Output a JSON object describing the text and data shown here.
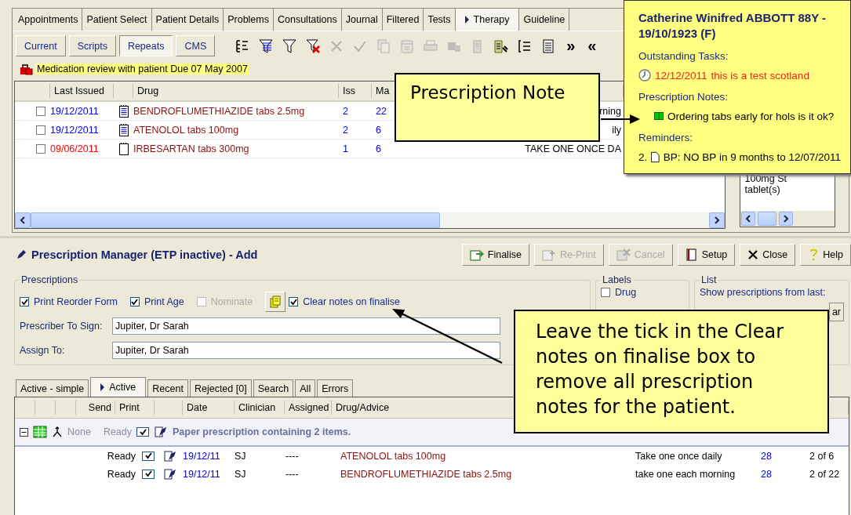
{
  "top_tabs": [
    {
      "label": "Appointments",
      "selected": false
    },
    {
      "label": "Patient Select",
      "selected": false
    },
    {
      "label": "Patient Details",
      "selected": false
    },
    {
      "label": "Problems",
      "selected": false
    },
    {
      "label": "Consultations",
      "selected": false
    },
    {
      "label": "Journal",
      "selected": false
    },
    {
      "label": "Filtered",
      "selected": false
    },
    {
      "label": "Tests",
      "selected": false
    },
    {
      "label": "Therapy",
      "selected": true
    },
    {
      "label": "Guideline",
      "selected": false
    }
  ],
  "therapy_toolbar": {
    "views": [
      {
        "label": "Current",
        "selected": false
      },
      {
        "label": "Scripts",
        "selected": false
      },
      {
        "label": "Repeats",
        "selected": true
      },
      {
        "label": "CMS",
        "selected": false
      }
    ],
    "tools": [
      {
        "kind": "tree-list",
        "disabled": false
      },
      {
        "kind": "filter-lines",
        "disabled": false
      },
      {
        "kind": "filter",
        "disabled": false
      },
      {
        "kind": "filter-delete",
        "disabled": false
      },
      {
        "kind": "cross",
        "disabled": true
      },
      {
        "kind": "tick",
        "disabled": true
      },
      {
        "kind": "copy",
        "disabled": true
      },
      {
        "kind": "calendar",
        "disabled": true
      },
      {
        "kind": "printer",
        "disabled": true
      },
      {
        "kind": "stamp",
        "disabled": true
      },
      {
        "kind": "form",
        "disabled": true
      },
      {
        "kind": "list-pen",
        "disabled": false
      },
      {
        "kind": "bracket-list",
        "disabled": false
      },
      {
        "kind": "page-list",
        "disabled": false
      }
    ],
    "expand": "»",
    "collapse": "«"
  },
  "alert": "Medication review with patient Due 07 May 2007",
  "repeats_table": {
    "columns": [
      "Last Issued",
      "Drug",
      "Iss",
      "Ma"
    ],
    "rows": [
      {
        "checked": false,
        "last_issued": "19/12/2011",
        "color": "#0000ff",
        "kind": "lined",
        "drug": "BENDROFLUMETHIAZIDE tabs 2.5mg",
        "iss": "2",
        "max": "22",
        "dosage": "rning"
      },
      {
        "checked": false,
        "last_issued": "19/12/2011",
        "color": "#0000ff",
        "kind": "lined",
        "drug": "ATENOLOL tabs 100mg",
        "iss": "2",
        "max": "6",
        "dosage": "ily"
      },
      {
        "checked": false,
        "last_issued": "09/06/2011",
        "color": "#ff0000",
        "kind": "plain",
        "drug": "IRBESARTAN tabs 300mg",
        "iss": "1",
        "max": "6",
        "dosage": "TAKE ONE ONCE DA"
      }
    ]
  },
  "side_panel": {
    "lines": [
      "100mg St",
      "tablet(s)"
    ]
  },
  "patient_popup": {
    "title": "Catherine Winifred ABBOTT 88Y - 19/10/1923 (F)",
    "sections": [
      {
        "heading": "Outstanding Tasks:",
        "kind": "task",
        "date": "12/12/2011",
        "text": "this is a test scotland"
      },
      {
        "heading": "Prescription Notes:",
        "kind": "note",
        "text": "Ordering tabs early for hols is it ok?"
      },
      {
        "heading": "Reminders:",
        "kind": "reminder",
        "number": "2.",
        "text": "BP: NO BP in 9 months to 12/07/2011"
      }
    ]
  },
  "prescription_manager": {
    "title": "Prescription Manager (ETP inactive) - Add",
    "actions": [
      {
        "label": "Finalise",
        "kind": "finalise",
        "disabled": false
      },
      {
        "label": "Re-Print",
        "kind": "reprint",
        "disabled": true
      },
      {
        "label": "Cancel",
        "kind": "cancel",
        "disabled": true
      },
      {
        "label": "Setup",
        "kind": "setup",
        "disabled": false
      },
      {
        "label": "Close",
        "kind": "close",
        "disabled": false
      },
      {
        "label": "Help",
        "kind": "help",
        "disabled": false
      }
    ],
    "prescriptions_group": {
      "title": "Prescriptions",
      "options": [
        {
          "label": "Print Reorder Form",
          "checked": true,
          "disabled": false
        },
        {
          "label": "Print Age",
          "checked": true,
          "disabled": false
        },
        {
          "label": "Nominate",
          "checked": false,
          "disabled": true
        }
      ],
      "clear_notes": {
        "label": "Clear notes on finalise",
        "checked": true
      },
      "fields": [
        {
          "label": "Prescriber To Sign:",
          "value": "Jupiter, Dr Sarah"
        },
        {
          "label": "Assign To:",
          "value": "Jupiter, Dr Sarah"
        }
      ]
    },
    "labels_group": {
      "title": "Labels",
      "options": [
        {
          "label": "Drug",
          "checked": false
        }
      ]
    },
    "list_group": {
      "title": "List",
      "text": "Show prescriptions from last:",
      "button": "ar"
    }
  },
  "issue_tabs": [
    {
      "label": "Active - simple",
      "selected": false
    },
    {
      "label": "Active",
      "selected": true
    },
    {
      "label": "Recent",
      "selected": false
    },
    {
      "label": "Rejected [0]",
      "selected": false
    },
    {
      "label": "Search",
      "selected": false
    },
    {
      "label": "All",
      "selected": false
    },
    {
      "label": "Errors",
      "selected": false
    }
  ],
  "issues_table": {
    "columns": [
      "Send",
      "Print",
      "Date",
      "Clinician",
      "Assigned",
      "Drug/Advice"
    ],
    "group": {
      "expanded": true,
      "send": "None",
      "print": "Ready",
      "checked": true,
      "text": "Paper prescription containing 2 items."
    },
    "rows": [
      {
        "print": "Ready",
        "checked": true,
        "date": "19/12/11",
        "clinician": "SJ",
        "assigned": "----",
        "drug": "ATENOLOL tabs 100mg",
        "dosage": "Take one once daily",
        "quantity": "28",
        "issue": "2 of 6"
      },
      {
        "print": "Ready",
        "checked": true,
        "date": "19/12/11",
        "clinician": "SJ",
        "assigned": "----",
        "drug": "BENDROFLUMETHIAZIDE tabs 2.5mg",
        "dosage": "take one each morning",
        "quantity": "28",
        "issue": "2 of 22"
      }
    ]
  },
  "note_callout": "Prescription Note",
  "clear_notes_callout": "Leave the tick in the Clear notes on finalise box to remove all prescription notes for the patient."
}
